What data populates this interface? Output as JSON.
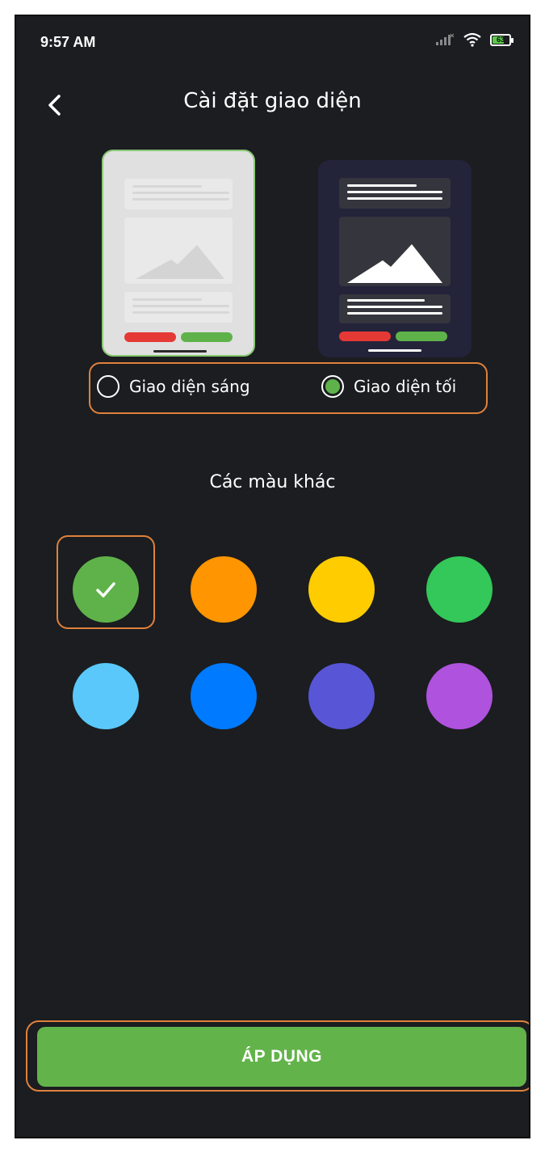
{
  "status_bar": {
    "time": "9:57 AM",
    "battery": "63",
    "icons": [
      "signal-icon",
      "wifi-icon",
      "battery-icon"
    ]
  },
  "header": {
    "title": "Cài đặt giao diện",
    "back_icon": "chevron-left-icon"
  },
  "theme": {
    "options": [
      {
        "label": "Giao diện sáng",
        "selected": false
      },
      {
        "label": "Giao diện tối",
        "selected": true
      }
    ]
  },
  "colors": {
    "title": "Các màu khác",
    "swatches": [
      "#5fb24a",
      "#ff9500",
      "#ffcc00",
      "#34c759",
      "#5ac8fa",
      "#007aff",
      "#5856d6",
      "#af52de"
    ],
    "selected_index": 0
  },
  "apply": {
    "label": "ÁP DỤNG"
  },
  "accent": "#63b34b",
  "highlight": "#e0813c"
}
